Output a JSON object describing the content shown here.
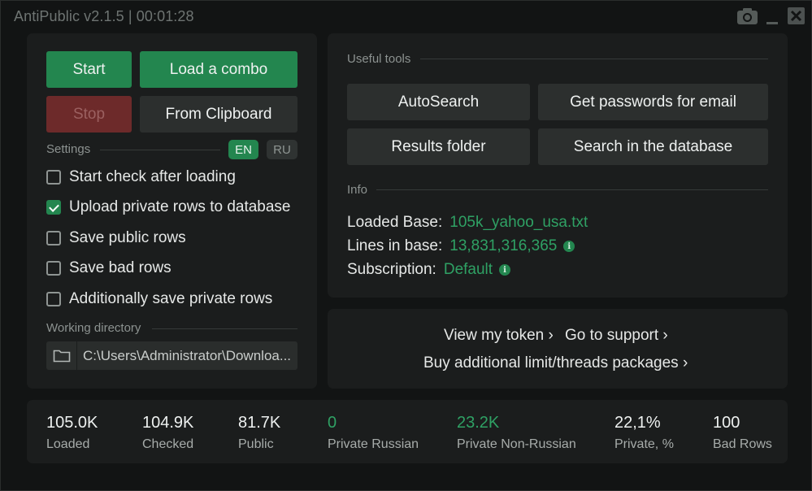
{
  "window": {
    "title": "AntiPublic v2.1.5 | 00:01:28"
  },
  "titlebar": {
    "camera_icon": "camera-icon",
    "minimize_label": "_",
    "close_icon": "close-icon"
  },
  "controls": {
    "start": "Start",
    "load_combo": "Load a combo",
    "stop": "Stop",
    "from_clipboard": "From Clipboard"
  },
  "settings": {
    "label": "Settings",
    "lang_en": "EN",
    "lang_ru": "RU",
    "options": [
      {
        "label": "Start check after loading",
        "checked": false
      },
      {
        "label": "Upload private rows to database",
        "checked": true
      },
      {
        "label": "Save public rows",
        "checked": false
      },
      {
        "label": "Save bad rows",
        "checked": false
      },
      {
        "label": "Additionally save private rows",
        "checked": false
      }
    ]
  },
  "working_directory": {
    "label": "Working directory",
    "path": "C:\\Users\\Administrator\\Downloa..."
  },
  "tools": {
    "label": "Useful tools",
    "autosearch": "AutoSearch",
    "get_passwords": "Get passwords for email",
    "results_folder": "Results folder",
    "search_db": "Search in the database"
  },
  "info": {
    "label": "Info",
    "loaded_base_key": "Loaded Base:",
    "loaded_base_val": "105k_yahoo_usa.txt",
    "lines_key": "Lines in base:",
    "lines_val": "13,831,316,365",
    "sub_key": "Subscription:",
    "sub_val": "Default"
  },
  "links": {
    "view_token": "View my token ›",
    "support": "Go to support ›",
    "buy": "Buy additional limit/threads packages ›"
  },
  "stats": [
    {
      "value": "105.0K",
      "label": "Loaded"
    },
    {
      "value": "104.9K",
      "label": "Checked"
    },
    {
      "value": "81.7K",
      "label": "Public"
    },
    {
      "value": "0",
      "label": "Private Russian"
    },
    {
      "value": "23.2K",
      "label": "Private Non-Russian"
    },
    {
      "value": "22,1%",
      "label": "Private, %"
    },
    {
      "value": "100",
      "label": "Bad Rows"
    }
  ],
  "colors": {
    "accent": "#23864f",
    "accent_text": "#2fa164",
    "stop": "#6d2a2a"
  }
}
